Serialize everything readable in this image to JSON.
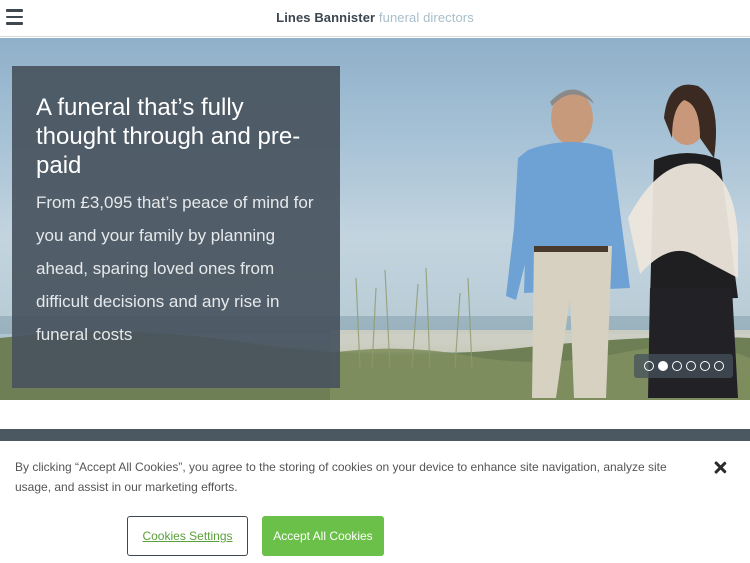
{
  "header": {
    "menu_icon": "hamburger-menu-icon",
    "brand_name": "Lines Bannister",
    "brand_suffix": "funeral directors"
  },
  "hero": {
    "title": "A funeral that’s fully thought through and pre-paid",
    "text": "From £3,095 that’s peace of mind for you and your family by planning ahead, sparing loved ones from difficult decisions and any rise in funeral costs",
    "slide_count": 6,
    "active_slide": 2
  },
  "cookie_banner": {
    "text": "By clicking “Accept All Cookies”, you agree to the storing of cookies on your device to enhance site navigation, analyze site usage, and assist in our marketing efforts.",
    "settings_label": "Cookies Settings",
    "accept_label": "Accept All Cookies",
    "close_icon": "close-icon"
  },
  "colors": {
    "panel": "#48545e",
    "accent_green": "#6bc049",
    "brand_dark": "#3c4650",
    "brand_light": "#a9bdca"
  }
}
